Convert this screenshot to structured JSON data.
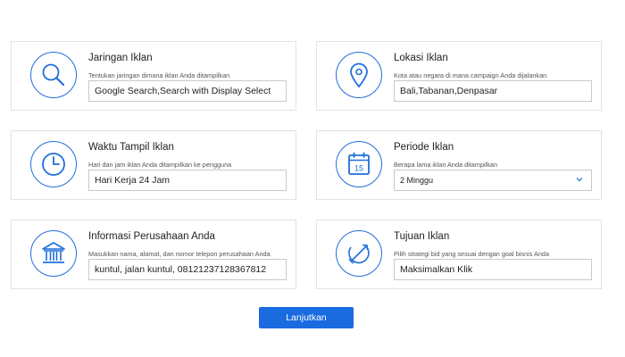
{
  "cards": [
    {
      "title": "Jaringan Iklan",
      "desc": "Tentukan jaringan dimana iklan Anda ditampilkan",
      "value": "Google Search,Search with Display Select",
      "icon": "search-icon"
    },
    {
      "title": "Lokasi Iklan",
      "desc": "Kota atau negara di mana campaign Anda dijalankan",
      "value": "Bali,Tabanan,Denpasar",
      "icon": "location-pin-icon"
    },
    {
      "title": "Waktu Tampil Iklan",
      "desc": "Hari dan jam iklan Anda ditampilkan ke pengguna",
      "value": "Hari Kerja 24 Jam",
      "icon": "clock-icon"
    },
    {
      "title": "Periode Iklan",
      "desc": "Berapa lama iklan Anda ditampilkan",
      "value": "2 Minggu",
      "icon": "calendar-icon",
      "calendar_day": "15"
    },
    {
      "title": "Informasi Perusahaan Anda",
      "desc": "Masukkan nama, alamat, dan nomor telepon perusahaan Anda",
      "value": "kuntul, jalan kuntul, 08121237128367812",
      "icon": "bank-building-icon"
    },
    {
      "title": "Tujuan Iklan",
      "desc": "Pilih strategi bid yang sesuai dengan goal bisnis Anda",
      "value": "Maksimalkan Klik",
      "icon": "target-arrow-icon"
    }
  ],
  "submit_label": "Lanjutkan",
  "colors": {
    "accent": "#1f6fd9",
    "button": "#1a6ae0"
  }
}
